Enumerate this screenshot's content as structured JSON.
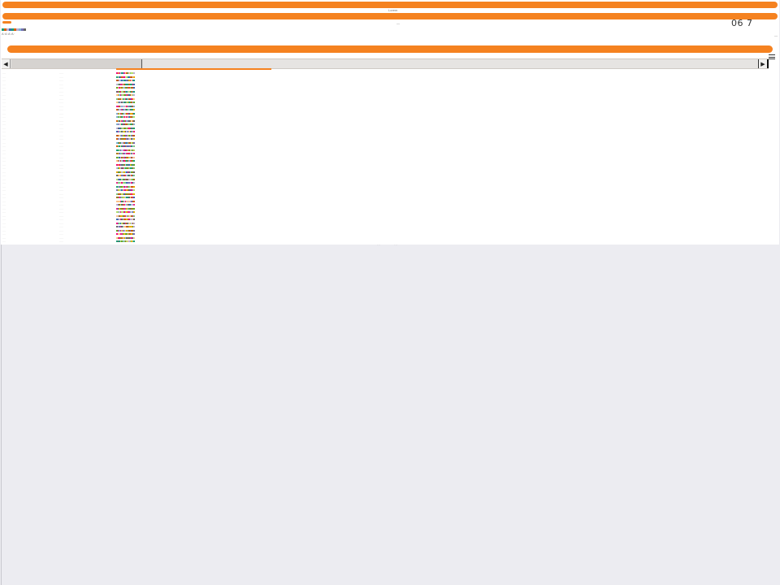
{
  "header": {
    "top_bar_label": "Lorem",
    "second_bar_label": "—",
    "counter": "06 7",
    "small_label_left": "A·A·A·A·",
    "small_label_right": "—"
  },
  "scrollbar": {
    "left_arrow": "◀",
    "right_arrow": "▶"
  },
  "colors": {
    "accent": "#f58220",
    "sequence_palette": [
      "#7fc97f",
      "#beaed4",
      "#fdc086",
      "#386cb0",
      "#f0027f",
      "#bf5b17",
      "#666666",
      "#1b9e77",
      "#d95f02",
      "#7570b3",
      "#e7298a",
      "#66a61e",
      "#e6ab02",
      "#a6761d",
      "#80b1d3",
      "#b3de69"
    ]
  },
  "rows_count_label": "",
  "table": {
    "rows": [
      [
        "····",
        "·····"
      ],
      [
        "····",
        "·····"
      ],
      [
        "····",
        "·····"
      ],
      [
        "····",
        "·····"
      ],
      [
        "····",
        "·····"
      ],
      [
        "····",
        "·····"
      ],
      [
        "····",
        "·····"
      ],
      [
        "····",
        "·····"
      ],
      [
        "····",
        "·····"
      ],
      [
        "····",
        "·····"
      ],
      [
        "····",
        "·····"
      ],
      [
        "····",
        "·····"
      ],
      [
        "····",
        "·····"
      ],
      [
        "····",
        "·····"
      ],
      [
        "····",
        "·····"
      ],
      [
        "····",
        "·····"
      ],
      [
        "····",
        "·····"
      ],
      [
        "····",
        "·····"
      ],
      [
        "····",
        "·····"
      ],
      [
        "····",
        "·····"
      ],
      [
        "····",
        "·····"
      ],
      [
        "····",
        "·····"
      ],
      [
        "····",
        "·····"
      ],
      [
        "····",
        "·····"
      ],
      [
        "····",
        "·····"
      ],
      [
        "····",
        "·····"
      ],
      [
        "····",
        "·····"
      ],
      [
        "····",
        "·····"
      ],
      [
        "····",
        "·····"
      ],
      [
        "····",
        "·····"
      ],
      [
        "····",
        "·····"
      ],
      [
        "····",
        "·····"
      ],
      [
        "····",
        "·····"
      ],
      [
        "····",
        "·····"
      ],
      [
        "····",
        "·····"
      ],
      [
        "····",
        "·····"
      ],
      [
        "····",
        "·····"
      ],
      [
        "····",
        "·····"
      ],
      [
        "····",
        "·····"
      ],
      [
        "····",
        "·····"
      ],
      [
        "····",
        "·····"
      ],
      [
        "····",
        "·····"
      ],
      [
        "····",
        "·····"
      ],
      [
        "····",
        "·····"
      ],
      [
        "····",
        "·····"
      ],
      [
        "····",
        "·····"
      ],
      [
        "····",
        "·····"
      ]
    ]
  },
  "footer": {
    "tick_a": "···",
    "tick_b": "···"
  }
}
